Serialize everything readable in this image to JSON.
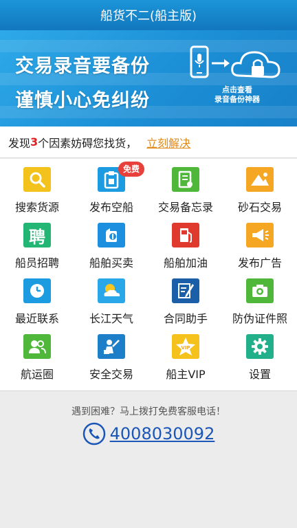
{
  "header": {
    "title": "船货不二(船主版)"
  },
  "banner": {
    "line1": "交易录音要备份",
    "line2": "谨慎小心免纠纷",
    "caption1": "点击查看",
    "caption2": "录音备份神器"
  },
  "notice": {
    "prefix": "发现",
    "count": "3",
    "suffix": "个因素妨碍您找货，",
    "action": "立刻解决"
  },
  "grid": {
    "items": [
      {
        "label": "搜索货源",
        "icon": "search-icon",
        "color": "#f3c21c"
      },
      {
        "label": "发布空船",
        "icon": "clipboard-icon",
        "color": "#1c9be0",
        "badge": "免费"
      },
      {
        "label": "交易备忘录",
        "icon": "memo-icon",
        "color": "#4fb83b"
      },
      {
        "label": "砂石交易",
        "icon": "sand-pile-icon",
        "color": "#f5a623"
      },
      {
        "label": "船员招聘",
        "icon": "recruit-icon",
        "color": "#22b573",
        "glyph": "聘"
      },
      {
        "label": "船舶买卖",
        "icon": "trade-icon",
        "color": "#1c8fde"
      },
      {
        "label": "船舶加油",
        "icon": "fuel-icon",
        "color": "#e03a2e"
      },
      {
        "label": "发布广告",
        "icon": "megaphone-icon",
        "color": "#f5a623"
      },
      {
        "label": "最近联系",
        "icon": "clock-icon",
        "color": "#1c9be0"
      },
      {
        "label": "长江天气",
        "icon": "weather-icon",
        "color": "#2aa7e8"
      },
      {
        "label": "合同助手",
        "icon": "contract-icon",
        "color": "#1a5fa8"
      },
      {
        "label": "防伪证件照",
        "icon": "camera-icon",
        "color": "#4fb83b"
      },
      {
        "label": "航运圈",
        "icon": "users-icon",
        "color": "#4fb83b"
      },
      {
        "label": "安全交易",
        "icon": "safe-trade-icon",
        "color": "#1c7fc8"
      },
      {
        "label": "船主VIP",
        "icon": "vip-star-icon",
        "color": "#f5c21c"
      },
      {
        "label": "设置",
        "icon": "gear-icon",
        "color": "#22b08b"
      }
    ]
  },
  "footer": {
    "hint": "遇到困难？马上拨打免费客服电话！",
    "phone": "4008030092"
  }
}
